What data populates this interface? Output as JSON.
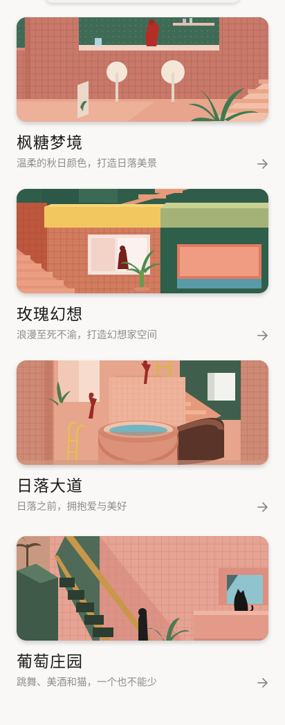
{
  "cards": [
    {
      "title": "枫糖梦境",
      "subtitle": "温柔的秋日颜色，打造日落美景",
      "image_icon": "autumn-room-illustration"
    },
    {
      "title": "玫瑰幻想",
      "subtitle": "浪漫至死不渝，打造幻想家空间",
      "image_icon": "rose-house-illustration"
    },
    {
      "title": "日落大道",
      "subtitle": "日落之前，拥抱爱与美好",
      "image_icon": "sunset-pool-illustration"
    },
    {
      "title": "葡萄庄园",
      "subtitle": "跳舞、美酒和猫，一个也不能少",
      "image_icon": "vineyard-cat-illustration"
    }
  ],
  "icons": {
    "arrow": "arrow-right-icon"
  },
  "colors": {
    "background": "#f9f8f7",
    "title": "#1b1b1b",
    "subtitle": "#8d8d8d",
    "arrow": "#8a8a8a"
  }
}
